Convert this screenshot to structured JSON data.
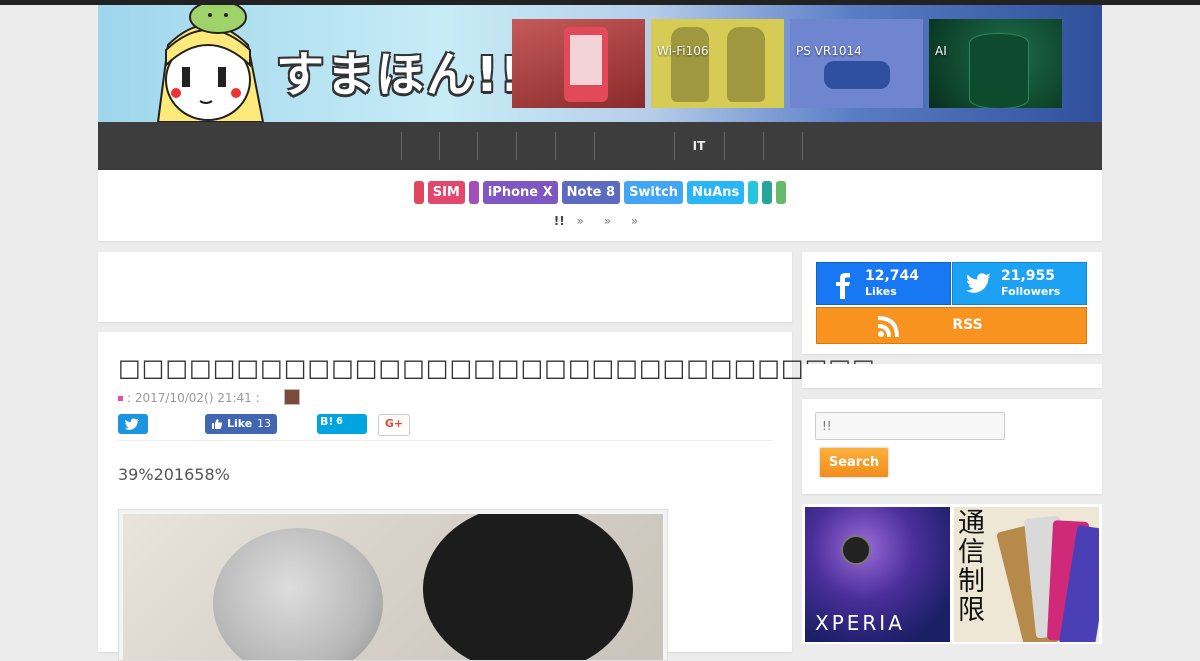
{
  "site": {
    "logo": "すまほん!!"
  },
  "featured": [
    {
      "caption": ""
    },
    {
      "caption": "Wi-Fi106"
    },
    {
      "caption": "PS VR1014"
    },
    {
      "caption": "AI"
    }
  ],
  "nav": {
    "items": [
      "",
      "",
      "",
      "",
      "",
      "",
      "IT",
      "",
      ""
    ]
  },
  "tags": [
    {
      "label": "",
      "color": "#e0475d"
    },
    {
      "label": "SIM",
      "color": "#e2476e"
    },
    {
      "label": "",
      "color": "#a34fbb"
    },
    {
      "label": "iPhone X",
      "color": "#7e57c2"
    },
    {
      "label": "Note 8",
      "color": "#5c6bc0"
    },
    {
      "label": "Switch",
      "color": "#42a5f5"
    },
    {
      "label": "NuAns",
      "color": "#29b6f6"
    },
    {
      "label": "",
      "color": "#26c6da"
    },
    {
      "label": "",
      "color": "#26a69a"
    },
    {
      "label": "",
      "color": "#66bb6a"
    }
  ],
  "breadcrumb": {
    "home": "!!",
    "sep": "»"
  },
  "article": {
    "title": "□□□□□□□□□□□□□□□□□□□□□□□□□□□□□□□□",
    "meta": ": 2017/10/02() 21:41     :",
    "share": {
      "fb_like": "Like",
      "fb_count": "13",
      "hatena": "B!",
      "hatena_count": "6",
      "gplus": "G+"
    },
    "lead": "39%201658%"
  },
  "sidebar": {
    "facebook": {
      "count": "12,744",
      "label": "Likes"
    },
    "twitter": {
      "count": "21,955",
      "label": "Followers"
    },
    "rss": {
      "label": "RSS"
    },
    "search": {
      "value": "!!",
      "button": "Search"
    },
    "ads": [
      {
        "caption": "XPERIA"
      },
      {
        "caption": "通信制限"
      }
    ]
  }
}
